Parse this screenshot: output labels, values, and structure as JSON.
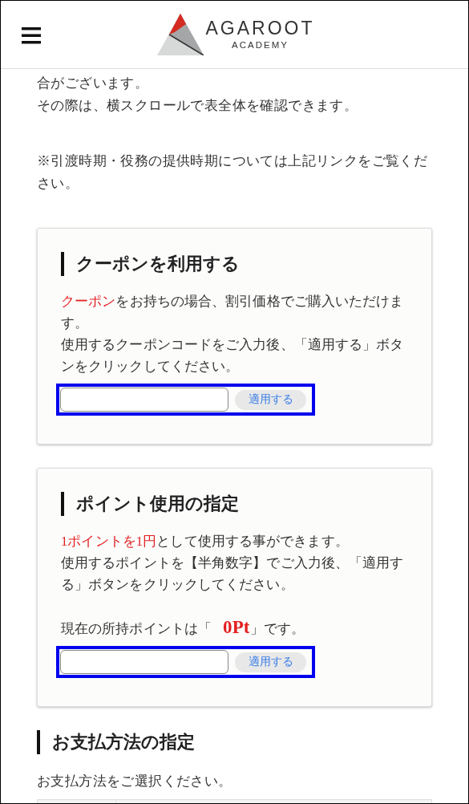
{
  "header": {
    "logo": {
      "name": "AGAROOT",
      "tagline": "ACADEMY"
    }
  },
  "intro": {
    "lines": [
      "合がございます。",
      "その際は、横スクロールで表全体を確認できます。"
    ],
    "note": "※引渡時期・役務の提供時期については上記リンクをご覧ください。"
  },
  "cards": [
    {
      "title": "クーポンを利用する",
      "paragraphs": [
        [
          {
            "text": "クーポン",
            "emphasis": true
          },
          {
            "text": "をお持ちの場合、割引価格でご購入いただけます。",
            "emphasis": false
          }
        ],
        [
          {
            "text": "使用するクーポンコードをご入力後、「適用する」ボタンをクリックしてください。",
            "emphasis": false
          }
        ]
      ],
      "form": {
        "highlighted": true,
        "button": "適用する"
      }
    },
    {
      "title": "ポイント使用の指定",
      "paragraphs": [
        [
          {
            "text": "1ポイントを1円",
            "emphasis": true
          },
          {
            "text": "として使用する事ができます。",
            "emphasis": false
          }
        ],
        [
          {
            "text": "使用するポイントを【半角数字】でご入力後、「適用する」ボタンをクリックしてください。",
            "emphasis": false
          }
        ]
      ],
      "balance": {
        "prefix": "現在の所持ポイントは「",
        "value": "0Pt",
        "suffix": "」です。"
      },
      "form": {
        "highlighted": true,
        "button": "適用する"
      }
    }
  ],
  "payment": {
    "title": "お支払方法の指定",
    "instruction": "お支払方法をご選択ください。"
  }
}
